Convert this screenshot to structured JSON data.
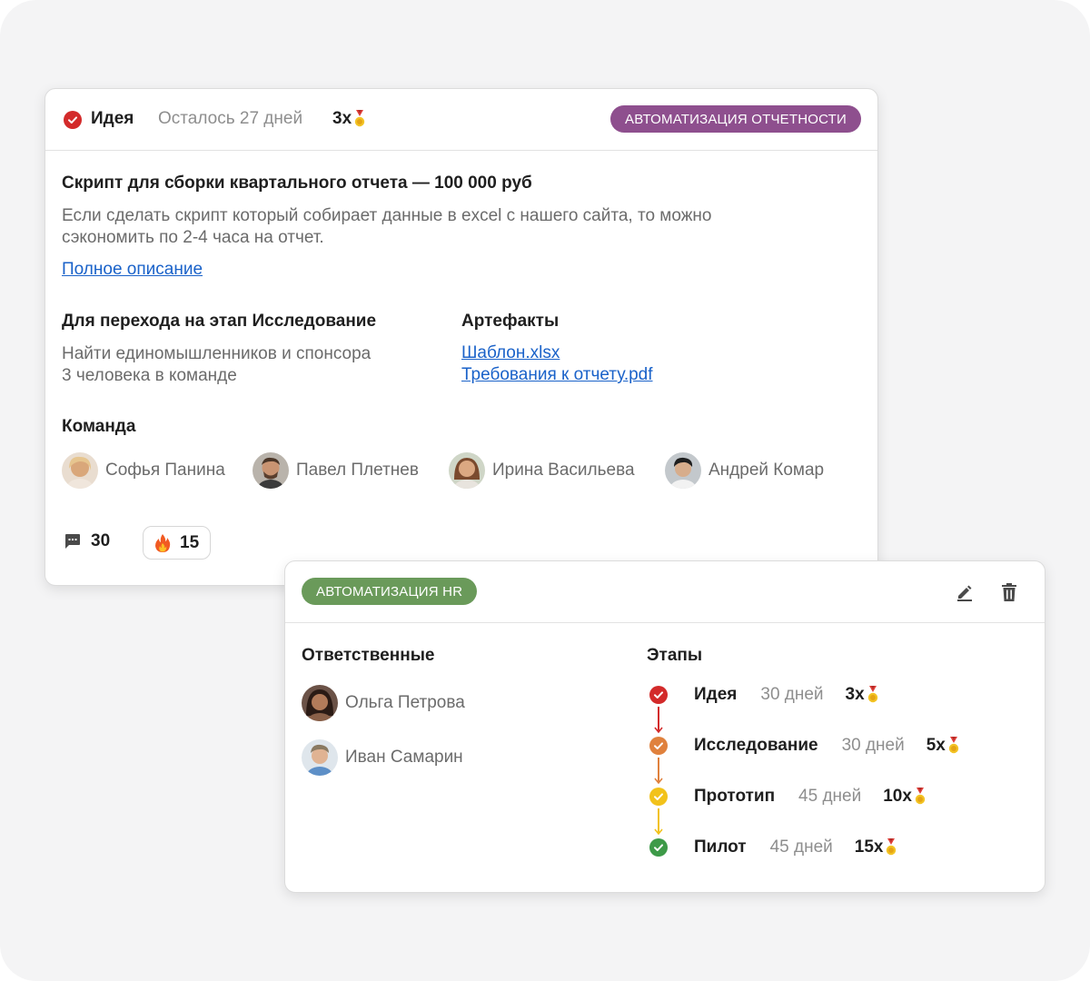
{
  "idea_card": {
    "stage": "Идея",
    "remaining": "Осталось 27 дней",
    "reward": "3x",
    "tag": "АВТОМАТИЗАЦИЯ ОТЧЕТНОСТИ",
    "title": "Скрипт для сборки квартального отчета — 100 000 руб",
    "description_line1": "Если сделать скрипт который собирает данные в excel с нашего сайта, то можно",
    "description_line2": "сэкономить по 2-4 часа на отчет.",
    "full_description_link": "Полное описание",
    "next_stage_heading": "Для перехода на этап Исследование",
    "next_stage_req1": "Найти единомышленников и спонсора",
    "next_stage_req2": "3 человека в команде",
    "artifacts_heading": "Артефакты",
    "artifacts": [
      "Шаблон.xlsx",
      "Требования к отчету.pdf"
    ],
    "team_heading": "Команда",
    "team": [
      "Софья Панина",
      "Павел Плетнев",
      "Ирина Васильева",
      "Андрей Комар"
    ],
    "comments_count": "30",
    "reactions_count": "15",
    "colors": {
      "tag": "#8e4f8e",
      "stage_check": "#d32a2a",
      "link": "#1a62c9"
    }
  },
  "hr_card": {
    "tag": "АВТОМАТИЗАЦИЯ HR",
    "responsible_heading": "Ответственные",
    "responsible": [
      "Ольга Петрова",
      "Иван Самарин"
    ],
    "stages_heading": "Этапы",
    "stages": [
      {
        "name": "Идея",
        "days": "30 дней",
        "reward": "3x",
        "color": "#d32a2a"
      },
      {
        "name": "Исследование",
        "days": "30 дней",
        "reward": "5x",
        "color": "#e0813d"
      },
      {
        "name": "Прототип",
        "days": "45 дней",
        "reward": "10x",
        "color": "#f2c21a"
      },
      {
        "name": "Пилот",
        "days": "45 дней",
        "reward": "15x",
        "color": "#3d9a48"
      }
    ],
    "colors": {
      "tag": "#6a9a5a"
    },
    "icons": [
      "edit-icon",
      "delete-icon"
    ]
  }
}
